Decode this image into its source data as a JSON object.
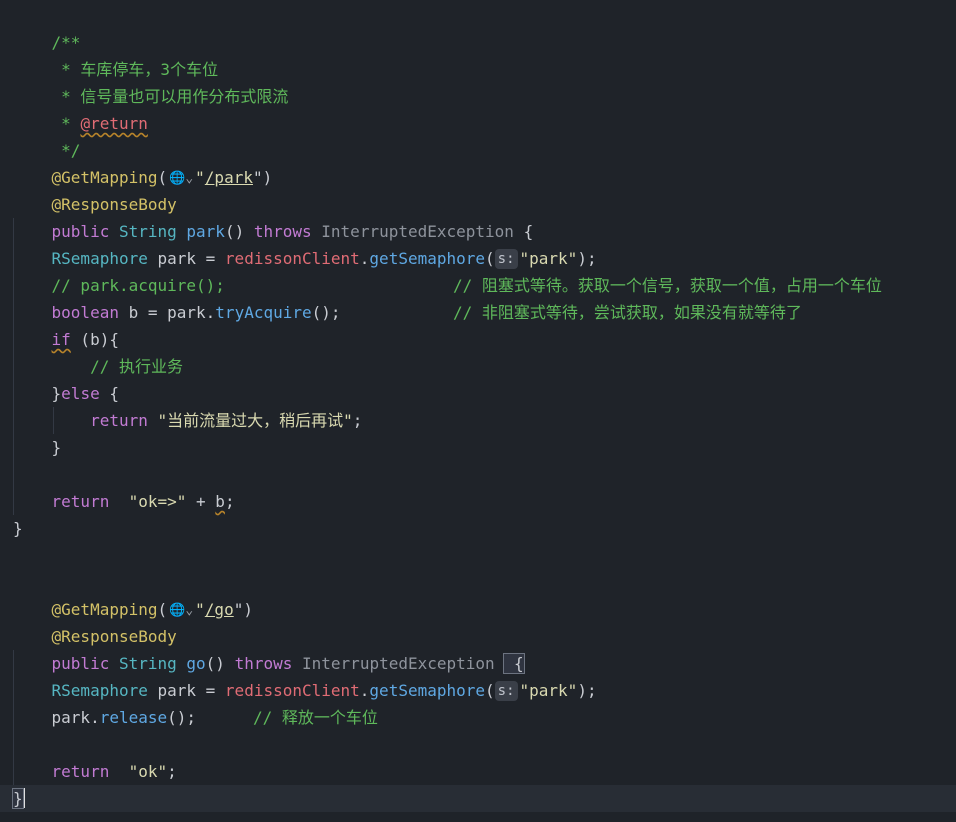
{
  "editor": {
    "language": "java",
    "lines": {
      "l1": "/**",
      "l2": " * 车库停车，3个车位",
      "l3": " * 信号量也可以用作分布式限流",
      "l4_prefix": " * ",
      "l4_tag": "@return",
      "l5": " */",
      "ann_get": "@GetMapping",
      "ann_open": "(",
      "hint_globe": "🌐⌄",
      "park_path_q1": "\"",
      "park_path": "/park",
      "park_path_q2": "\")",
      "ann_resp": "@ResponseBody",
      "kw_public": "public",
      "ty_string": "String",
      "fn_park": "park",
      "parens_open": "() ",
      "kw_throws": "throws",
      "cls_exc": "InterruptedException",
      "brace_open": " {",
      "ty_rsem": "RSemaphore",
      "var_park_assign": " park = ",
      "fd_client": "redissonClient",
      "dot": ".",
      "fn_getsem": "getSemaphore",
      "paren_o": "(",
      "hint_s": "s:",
      "str_park": "\"park\"",
      "paren_c_semi": ");",
      "cm_acquire": "// park.acquire();",
      "cm_block": "// 阻塞式等待。获取一个信号，获取一个值，占用一个车位",
      "kw_boolean": "boolean",
      "var_b_assign": " b = park.",
      "fn_tryacquire": "tryAcquire",
      "call_end": "();",
      "cm_nonblock": "// 非阻塞式等待，尝试获取，如果没有就等待了",
      "kw_if": "if",
      "if_cond": " (b){",
      "cm_business": "// 执行业务",
      "else_brace": "}",
      "kw_else": "else",
      "else_open": " {",
      "kw_return": "return",
      "str_retry": " \"当前流量过大，稍后再试\"",
      "semi": ";",
      "brace_close": "}",
      "str_ok_concat": "  \"ok=>\"",
      "plus": " + ",
      "var_b": "b",
      "go_path": "/go",
      "fn_go": "go",
      "fn_release": "release",
      "cm_release": "// 释放一个车位",
      "str_ok": "  \"ok\""
    }
  }
}
